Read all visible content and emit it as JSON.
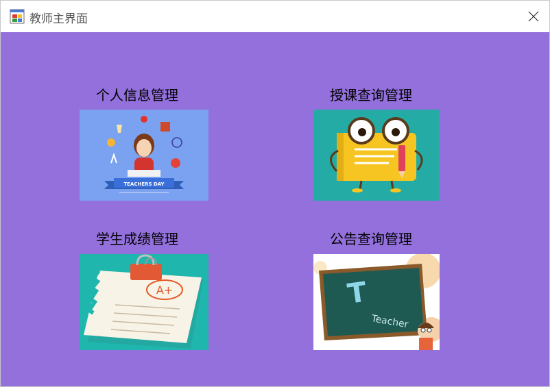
{
  "window": {
    "title": "教师主界面",
    "background_color": "#9370db",
    "close_icon": "close-icon",
    "app_icon": "app-form-icon"
  },
  "modules": [
    {
      "label": "个人信息管理",
      "image": "teacher-day-illustration",
      "banner_text": "TEACHERS DAY"
    },
    {
      "label": "授课查询管理",
      "image": "cartoon-book-illustration"
    },
    {
      "label": "学生成绩管理",
      "image": "graded-paper-illustration",
      "grade_text": "A+"
    },
    {
      "label": "公告查询管理",
      "image": "chalkboard-illustration",
      "board_text": "Teacher"
    }
  ]
}
